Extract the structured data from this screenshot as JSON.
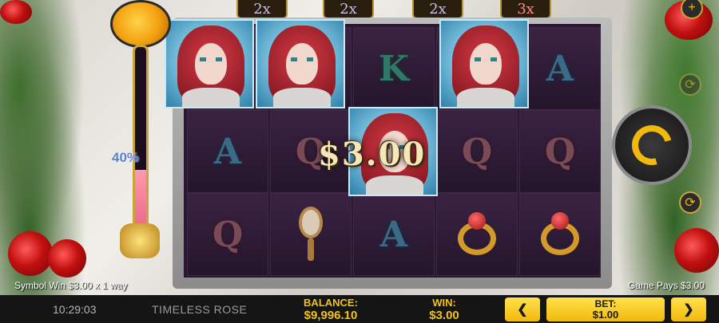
{
  "game": {
    "title": "TIMELESS ROSE",
    "clock": "10:29:03",
    "multipliers": [
      "2x",
      "2x",
      "2x",
      "3x"
    ],
    "meter": {
      "percent_label": "40%",
      "fill_fraction": 0.4
    },
    "win_overlay": "$3.00",
    "symbol_win": "Symbol Win $3.00 x 1 way",
    "game_pays": "Game Pays $3.00",
    "reels": [
      [
        "portrait",
        "A",
        "Q"
      ],
      [
        "portrait",
        "Q",
        "mirror"
      ],
      [
        "K",
        "portrait",
        "A"
      ],
      [
        "portrait",
        "Q",
        "ring"
      ],
      [
        "A",
        "Q",
        "ring"
      ]
    ]
  },
  "footer": {
    "balance_label": "BALANCE:",
    "balance_value": "$9,996.10",
    "win_label": "WIN:",
    "win_value": "$3.00",
    "bet_label": "BET:",
    "bet_value": "$1.00",
    "bet_decrease": "❮",
    "bet_increase": "❯"
  },
  "controls": {
    "plus": "+",
    "autoplay": "⟳",
    "spin": "spin"
  },
  "colors": {
    "accent": "#f1b90e",
    "meter_fill": "#e0557a",
    "percent_text": "#5b7fd1"
  }
}
